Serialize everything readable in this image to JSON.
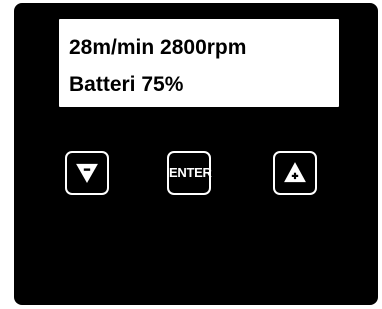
{
  "display": {
    "line1": "28m/min 2800rpm",
    "line2": "Batteri 75%"
  },
  "keypad": {
    "down_icon": "down-triangle-minus-icon",
    "enter_label": "ENTER",
    "up_icon": "up-triangle-plus-icon"
  },
  "colors": {
    "panel": "#000000",
    "display_background": "#ffffff",
    "display_text": "#000000",
    "key_outline": "#ffffff"
  }
}
